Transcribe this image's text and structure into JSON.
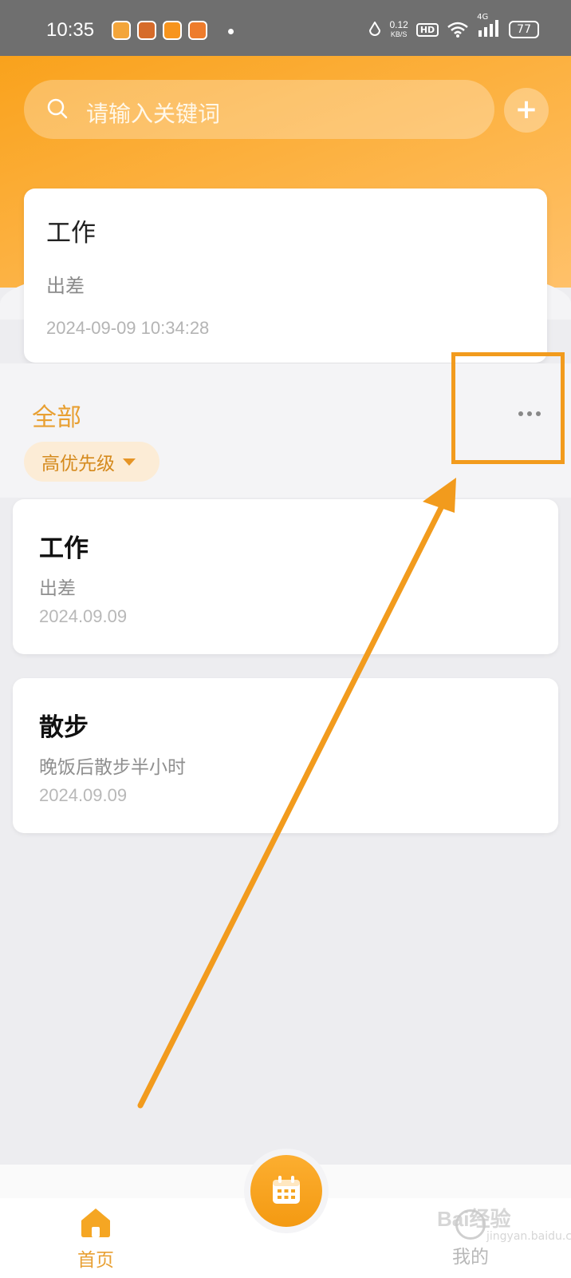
{
  "status_bar": {
    "time": "10:35",
    "net_speed_value": "0.12",
    "net_speed_unit": "KB/S",
    "hd": "HD",
    "network": "4G",
    "battery": "77"
  },
  "search": {
    "placeholder": "请输入关键词",
    "add_label": "+"
  },
  "featured": {
    "title": "工作",
    "description": "出差",
    "timestamp": "2024-09-09 10:34:28"
  },
  "section": {
    "title": "全部",
    "filter_label": "高优先级"
  },
  "tasks": [
    {
      "title": "工作",
      "description": "出差",
      "date": "2024.09.09"
    },
    {
      "title": "散步",
      "description": "晚饭后散步半小时",
      "date": "2024.09.09"
    }
  ],
  "nav": {
    "home_label": "首页",
    "mine_label": "我的"
  },
  "watermark": {
    "brand": "Bai经验",
    "sub": "jingyan.baidu.com"
  },
  "colors": {
    "accent": "#f5a623",
    "annotation": "#f29b1d"
  }
}
